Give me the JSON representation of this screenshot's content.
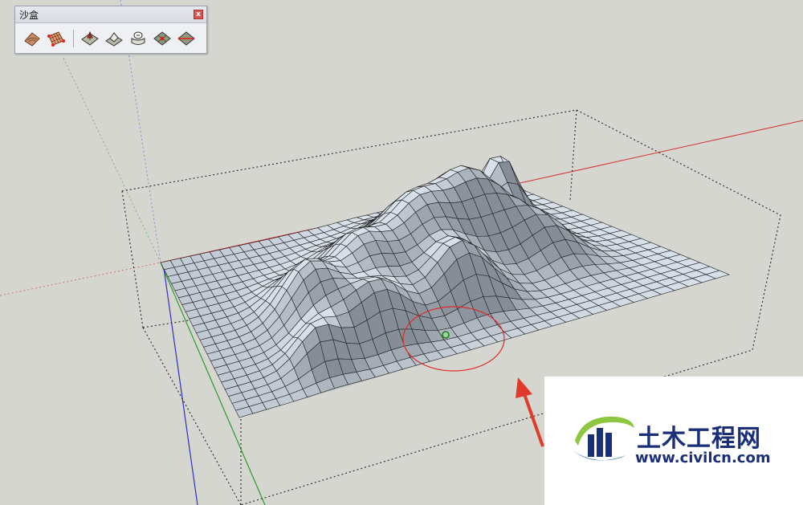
{
  "toolbar": {
    "title": "沙盒",
    "close_label": "x",
    "tools": [
      {
        "name": "from-contours-tool-icon"
      },
      {
        "name": "from-scratch-tool-icon"
      },
      {
        "name": "smoove-tool-icon"
      },
      {
        "name": "stamp-tool-icon"
      },
      {
        "name": "drape-tool-icon"
      },
      {
        "name": "add-detail-tool-icon"
      },
      {
        "name": "flip-edge-tool-icon"
      }
    ]
  },
  "watermark": {
    "site_name": "土木工程网",
    "url": "www.civilcn.com"
  },
  "colors": {
    "background": "#d4d6cf",
    "terrain_face": "#c8d2dc",
    "terrain_edge": "#222222",
    "axis_red": "#d43030",
    "axis_green": "#2f9a2f",
    "axis_blue": "#3030c0",
    "smoove_circle": "#e02a2a",
    "arrow": "#e03a2a",
    "logo_blue": "#1a2f78",
    "logo_green": "#8dc63f"
  }
}
